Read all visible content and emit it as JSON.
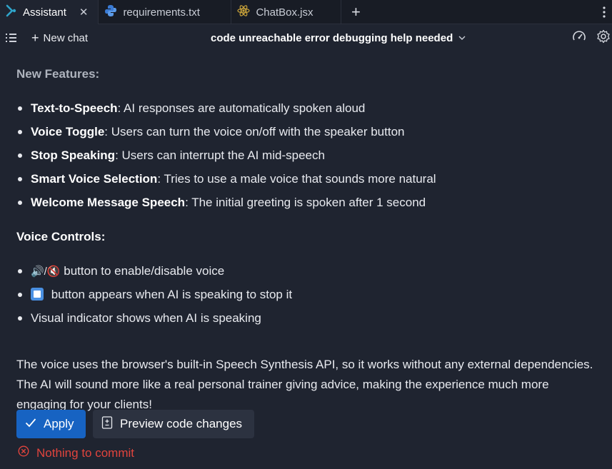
{
  "tabs": [
    {
      "label": "Assistant",
      "icon": "assistant-icon",
      "active": true,
      "close": "✕"
    },
    {
      "label": "requirements.txt",
      "icon": "python-icon",
      "active": false
    },
    {
      "label": "ChatBox.jsx",
      "icon": "react-icon",
      "active": false
    }
  ],
  "tabbar": {
    "add_label": "+",
    "more_icon": "kebab-menu-icon"
  },
  "toolbar": {
    "new_chat_label": "New chat",
    "chat_title": "code unreachable error debugging help needed",
    "right_icons": [
      "gauge-icon",
      "gear-icon"
    ]
  },
  "message": {
    "new_features_heading": "New Features:",
    "features": [
      {
        "title": "Text-to-Speech",
        "desc": ": AI responses are automatically spoken aloud"
      },
      {
        "title": "Voice Toggle",
        "desc": ": Users can turn the voice on/off with the speaker button"
      },
      {
        "title": "Stop Speaking",
        "desc": ": Users can interrupt the AI mid-speech"
      },
      {
        "title": "Smart Voice Selection",
        "desc": ": Tries to use a male voice that sounds more natural"
      },
      {
        "title": "Welcome Message Speech",
        "desc": ": The initial greeting is spoken after 1 second"
      }
    ],
    "voice_controls_heading": "Voice Controls:",
    "controls": [
      {
        "prefix": "🔊/🔇",
        "text": " button to enable/disable voice"
      },
      {
        "prefix": "⏹",
        "text": " button appears when AI is speaking to stop it"
      },
      {
        "prefix": "",
        "text": "Visual indicator shows when AI is speaking"
      }
    ],
    "paragraph": "The voice uses the browser's built-in Speech Synthesis API, so it works without any external dependencies. The AI will sound more like a real personal trainer giving advice, making the experience much more engaging for your clients!"
  },
  "actions": {
    "apply_label": "Apply",
    "preview_label": "Preview code changes"
  },
  "status": {
    "text": "Nothing to commit",
    "color": "#e0443d"
  },
  "colors": {
    "accent": "#1763c2",
    "background": "#1f2430",
    "error": "#e0443d"
  }
}
